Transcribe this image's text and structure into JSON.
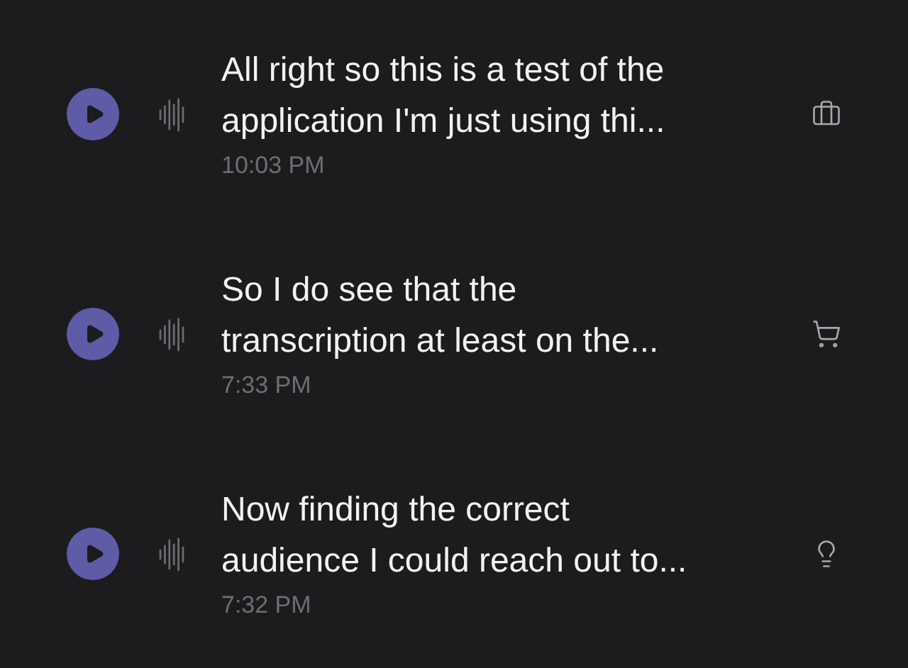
{
  "recordings": [
    {
      "lines": [
        "All right so this is a test of the",
        "application I'm just using thi..."
      ],
      "time": "10:03 PM",
      "kind": "briefcase"
    },
    {
      "lines": [
        "So I do see that the",
        "transcription at least on the..."
      ],
      "time": "7:33 PM",
      "kind": "cart"
    },
    {
      "lines": [
        "Now finding the correct",
        "audience I could reach out to..."
      ],
      "time": "7:32 PM",
      "kind": "lightbulb"
    }
  ]
}
